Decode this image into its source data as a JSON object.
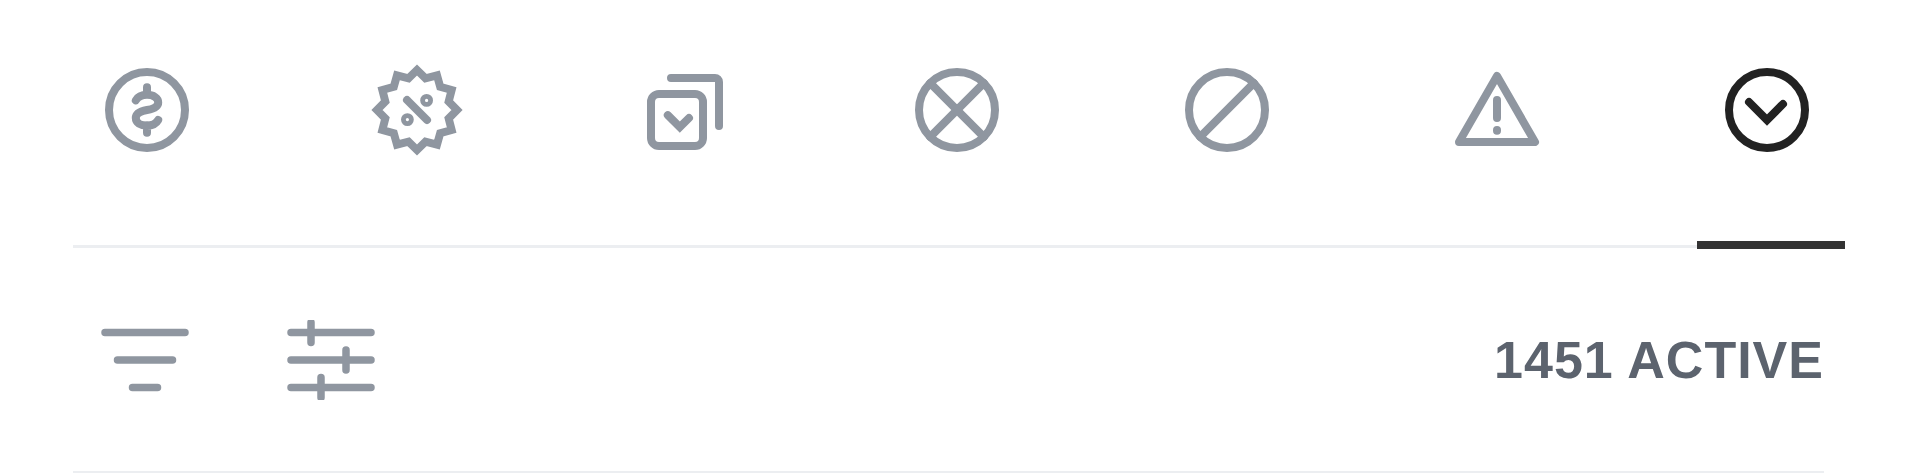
{
  "tabs": [
    {
      "kind": "dollar",
      "selected": false
    },
    {
      "kind": "badge",
      "selected": false
    },
    {
      "kind": "copy-check",
      "selected": false
    },
    {
      "kind": "circle-x",
      "selected": false
    },
    {
      "kind": "ban",
      "selected": false
    },
    {
      "kind": "warning",
      "selected": false
    },
    {
      "kind": "check-circle",
      "selected": true
    }
  ],
  "count": {
    "text": "1451 ACTIVE"
  }
}
